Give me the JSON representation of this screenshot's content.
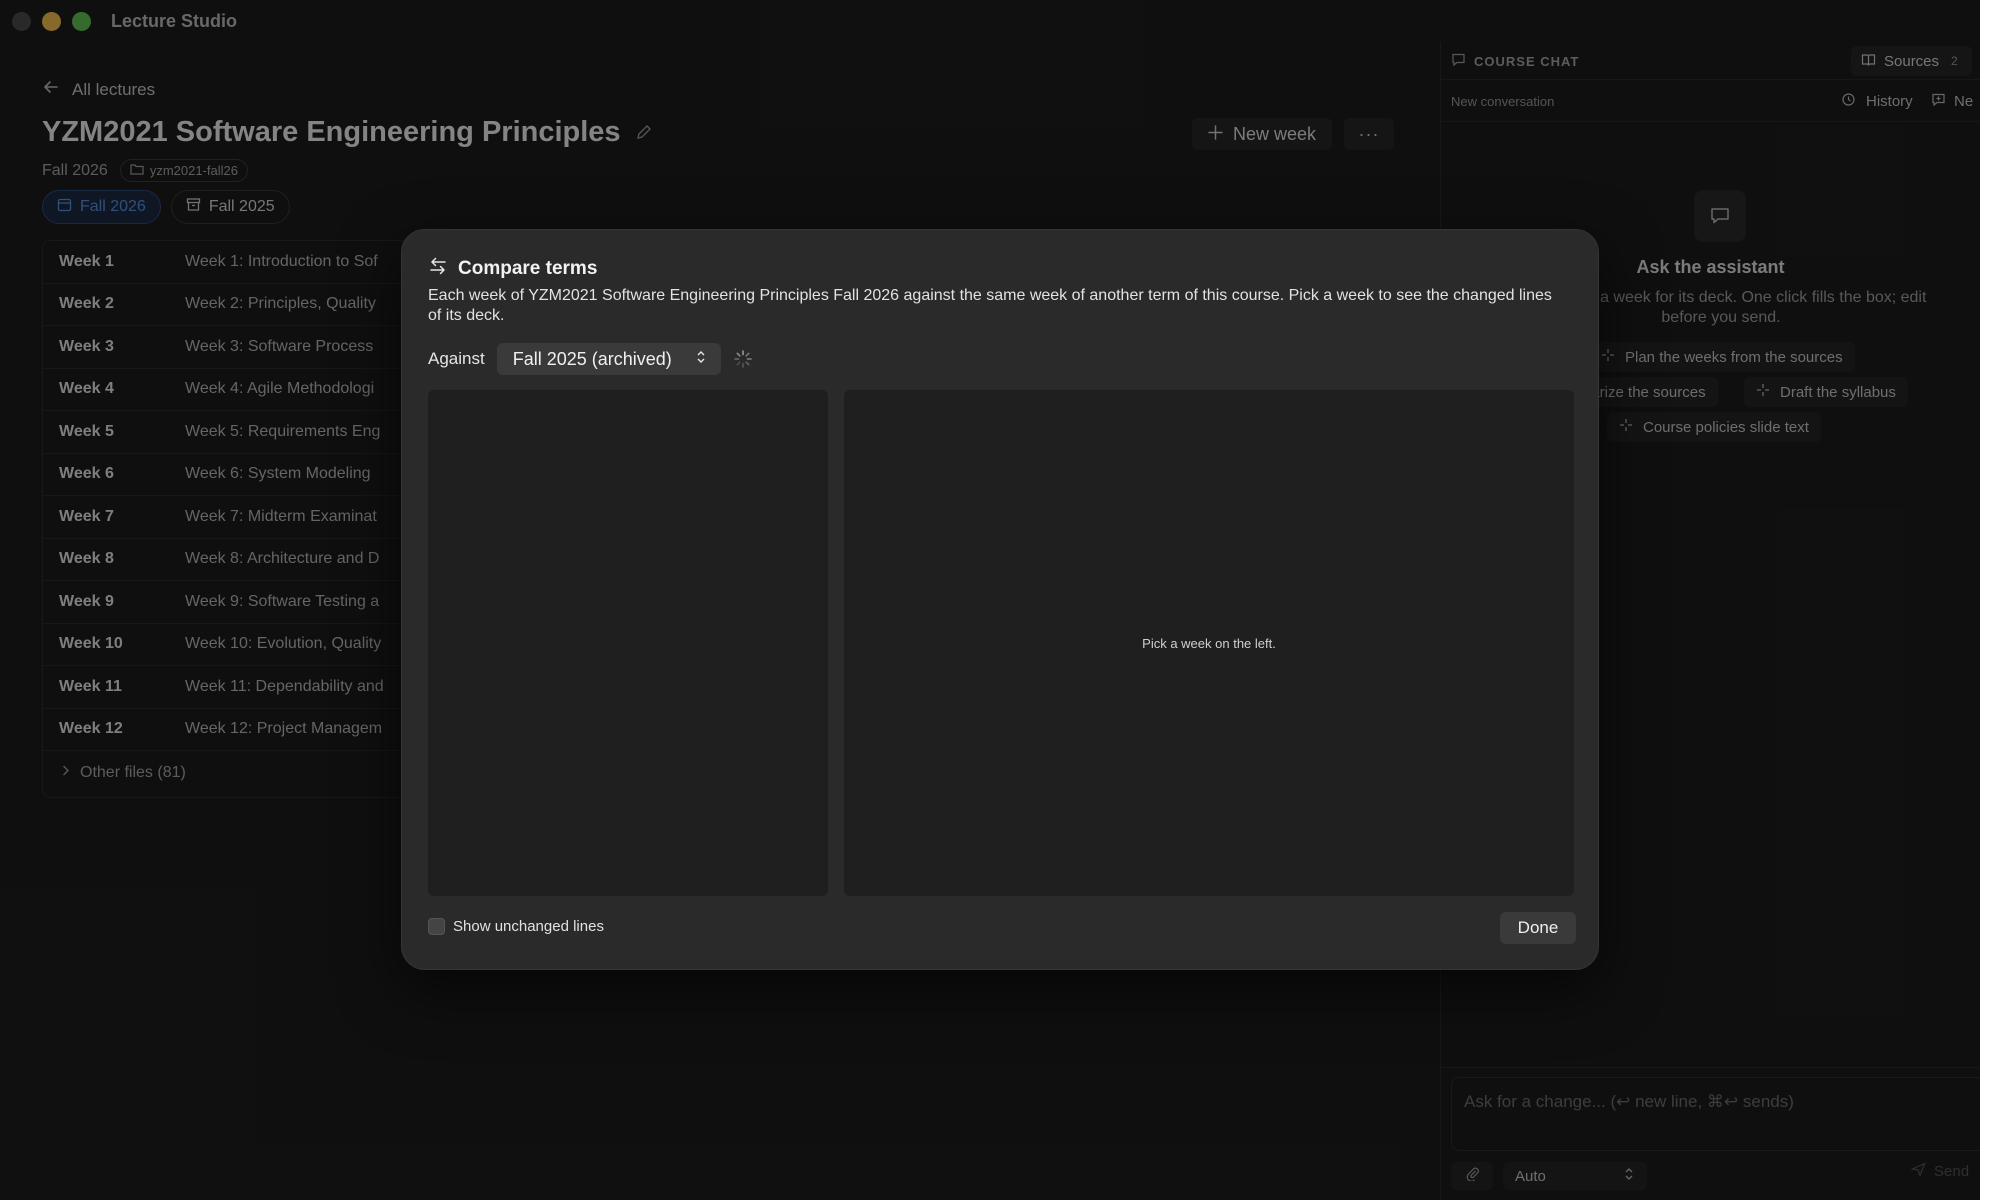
{
  "app": {
    "title": "Lecture Studio"
  },
  "main": {
    "back_label": "All lectures",
    "course_title": "YZM2021 Software Engineering Principles",
    "term": "Fall 2026",
    "folder": "yzm2021-fall26",
    "new_week_label": "New week",
    "more_label": "···",
    "term_tabs": [
      {
        "label": "Fall 2026",
        "active": true
      },
      {
        "label": "Fall 2025",
        "active": false
      }
    ],
    "weeks": [
      {
        "num": "Week 1",
        "title": "Week 1: Introduction to Sof"
      },
      {
        "num": "Week 2",
        "title": "Week 2: Principles, Quality"
      },
      {
        "num": "Week 3",
        "title": "Week 3: Software Process"
      },
      {
        "num": "Week 4",
        "title": "Week 4: Agile Methodologi"
      },
      {
        "num": "Week 5",
        "title": "Week 5: Requirements Eng"
      },
      {
        "num": "Week 6",
        "title": "Week 6: System Modeling"
      },
      {
        "num": "Week 7",
        "title": "Week 7: Midterm Examinat"
      },
      {
        "num": "Week 8",
        "title": "Week 8: Architecture and D"
      },
      {
        "num": "Week 9",
        "title": "Week 9: Software Testing a"
      },
      {
        "num": "Week 10",
        "title": "Week 10: Evolution, Quality"
      },
      {
        "num": "Week 11",
        "title": "Week 11: Dependability and"
      },
      {
        "num": "Week 12",
        "title": "Week 12: Project Managem"
      }
    ],
    "other_files": "Other files (81)"
  },
  "sidebar": {
    "header_label": "COURSE CHAT",
    "sources_label": "Sources",
    "sources_count": "2",
    "new_conversation": "New conversation",
    "history_label": "History",
    "new_label": "Ne",
    "assistant_title": "Ask the assistant",
    "assistant_help": "se, or open a week for its deck. One click fills the box; edit before you send.",
    "suggestions": [
      "Plan the weeks from the sources",
      "narize the sources",
      "Draft the syllabus",
      "Course policies slide text"
    ],
    "composer_placeholder": "Ask for a change... (↩ new line, ⌘↩ sends)",
    "model_value": "Auto",
    "send_label": "Send"
  },
  "modal": {
    "title": "Compare terms",
    "description": "Each week of YZM2021 Software Engineering Principles Fall 2026 against the same week of another term of this course. Pick a week to see the changed lines of its deck.",
    "against_label": "Against",
    "against_value": "Fall 2025 (archived)",
    "right_pane_hint": "Pick a week on the left.",
    "show_unchanged_label": "Show unchanged lines",
    "show_unchanged_checked": false,
    "done_label": "Done"
  },
  "colors": {
    "accent_blue": "#5c8fe0",
    "traffic_yellow": "#f4bf4f",
    "traffic_green": "#61c554",
    "background": "#1d1d1d"
  }
}
